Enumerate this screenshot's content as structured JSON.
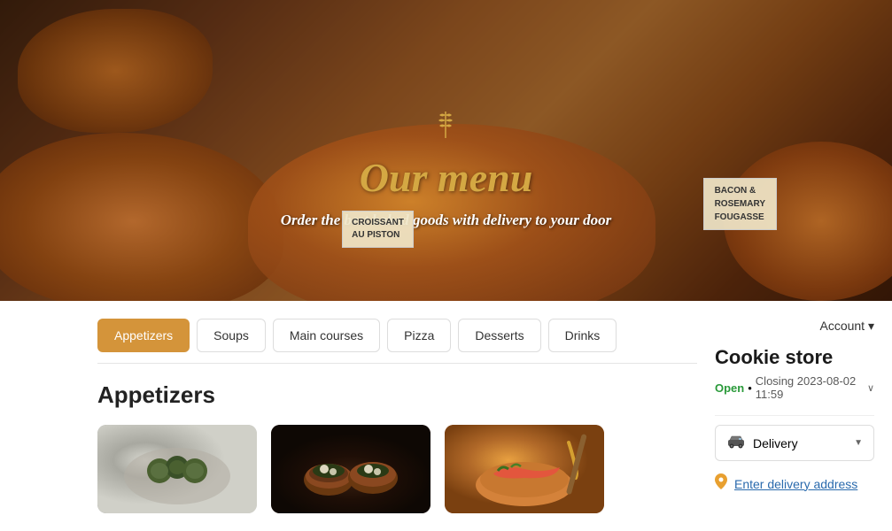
{
  "hero": {
    "title": "Our menu",
    "subtitle": "Order the best baked goods with delivery to your door",
    "wheat_icon": "❧",
    "sign1_line1": "CROISSANT",
    "sign1_line2": "AU PISTON",
    "sign2_line1": "BACON &",
    "sign2_line2": "ROSEMARY",
    "sign2_line3": "FOUGASSE"
  },
  "categories": {
    "tabs": [
      {
        "label": "Appetizers",
        "active": true
      },
      {
        "label": "Soups",
        "active": false
      },
      {
        "label": "Main courses",
        "active": false
      },
      {
        "label": "Pizza",
        "active": false
      },
      {
        "label": "Desserts",
        "active": false
      },
      {
        "label": "Drinks",
        "active": false
      }
    ]
  },
  "section": {
    "title": "Appetizers"
  },
  "sidebar": {
    "account_label": "Account",
    "account_arrow": "▾",
    "store_name": "Cookie store",
    "status_open": "Open",
    "status_dot": "•",
    "status_closing": "Closing 2023-08-02 11:59",
    "status_arrow": "∨",
    "delivery_label": "Delivery",
    "delivery_address_label": "Enter delivery address",
    "car_icon": "🚗",
    "pin_icon": "📍"
  }
}
